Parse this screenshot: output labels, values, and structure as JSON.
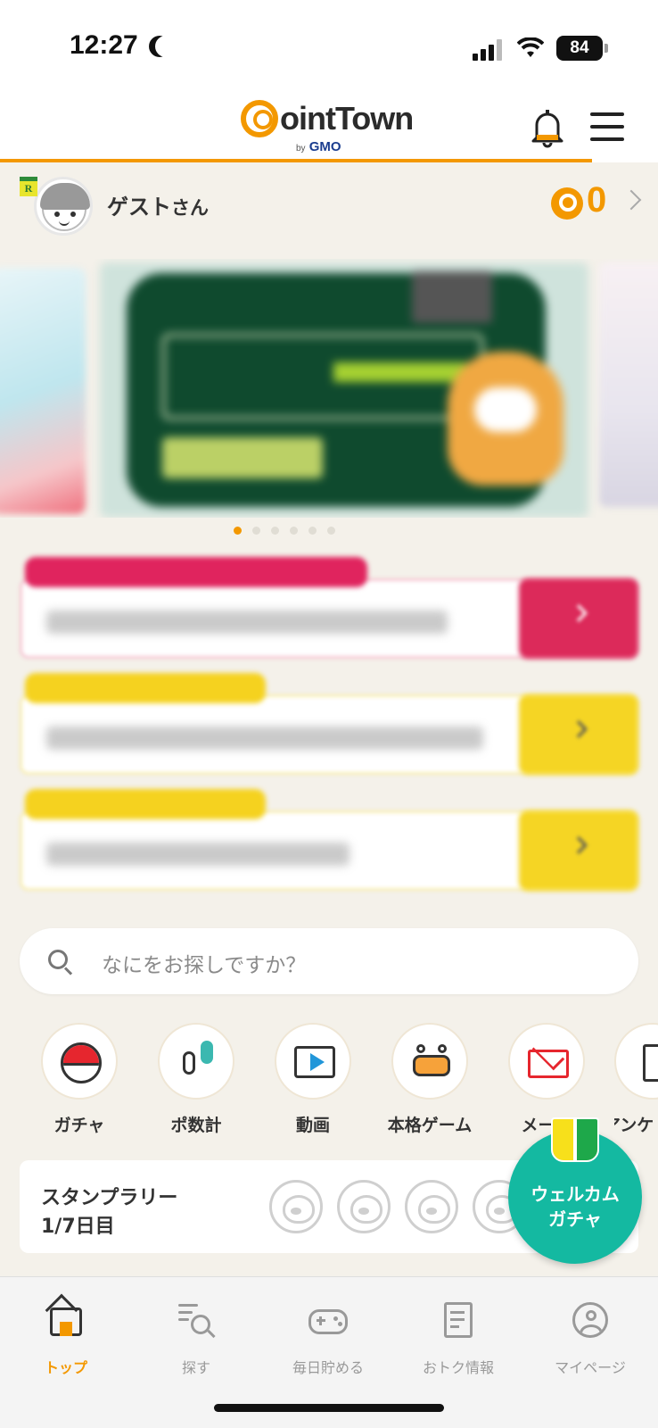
{
  "status_bar": {
    "time": "12:27",
    "battery": "84"
  },
  "header": {
    "logo_text": "ointTown",
    "logo_by": "by",
    "logo_brand": "GMO",
    "icons": {
      "notifications": "bell-icon",
      "menu": "hamburger-menu-icon"
    }
  },
  "user": {
    "name": "ゲスト",
    "suffix": "さん",
    "rank_badge": "R",
    "points": "0"
  },
  "banner": {
    "slides": 3,
    "active_slide": 1
  },
  "campaigns": [
    {
      "tag_color": "#e0245e",
      "button_color": "#dc2a5a"
    },
    {
      "tag_color": "#f5d21f",
      "button_color": "#f5d524"
    },
    {
      "tag_color": "#f5d21f",
      "button_color": "#f5d524"
    }
  ],
  "search": {
    "placeholder": "なにをお探しですか？"
  },
  "quick_menu": [
    {
      "label": "ガチャ",
      "icon": "gacha-ball-icon"
    },
    {
      "label": "ポ数計",
      "icon": "footsteps-icon"
    },
    {
      "label": "動画",
      "icon": "video-play-icon"
    },
    {
      "label": "本格ゲーム",
      "icon": "game-robot-icon"
    },
    {
      "label": "メール",
      "icon": "mail-icon"
    },
    {
      "label": "アンケ",
      "icon": "survey-icon"
    }
  ],
  "stamp_rally": {
    "title": "スタンプラリー",
    "day": "1/7日目",
    "stamps": 4
  },
  "welcome_gacha": {
    "line1": "ウェルカム",
    "line2": "ガチャ"
  },
  "bottom_nav": [
    {
      "label": "トップ",
      "icon": "home-icon",
      "active": true
    },
    {
      "label": "探す",
      "icon": "search-list-icon",
      "active": false
    },
    {
      "label": "毎日貯める",
      "icon": "gamepad-icon",
      "active": false
    },
    {
      "label": "おトク情報",
      "icon": "newspaper-icon",
      "active": false
    },
    {
      "label": "マイページ",
      "icon": "account-icon",
      "active": false
    }
  ],
  "colors": {
    "accent": "#f39800",
    "teal": "#14b9a1",
    "background": "#f4f1ea"
  }
}
